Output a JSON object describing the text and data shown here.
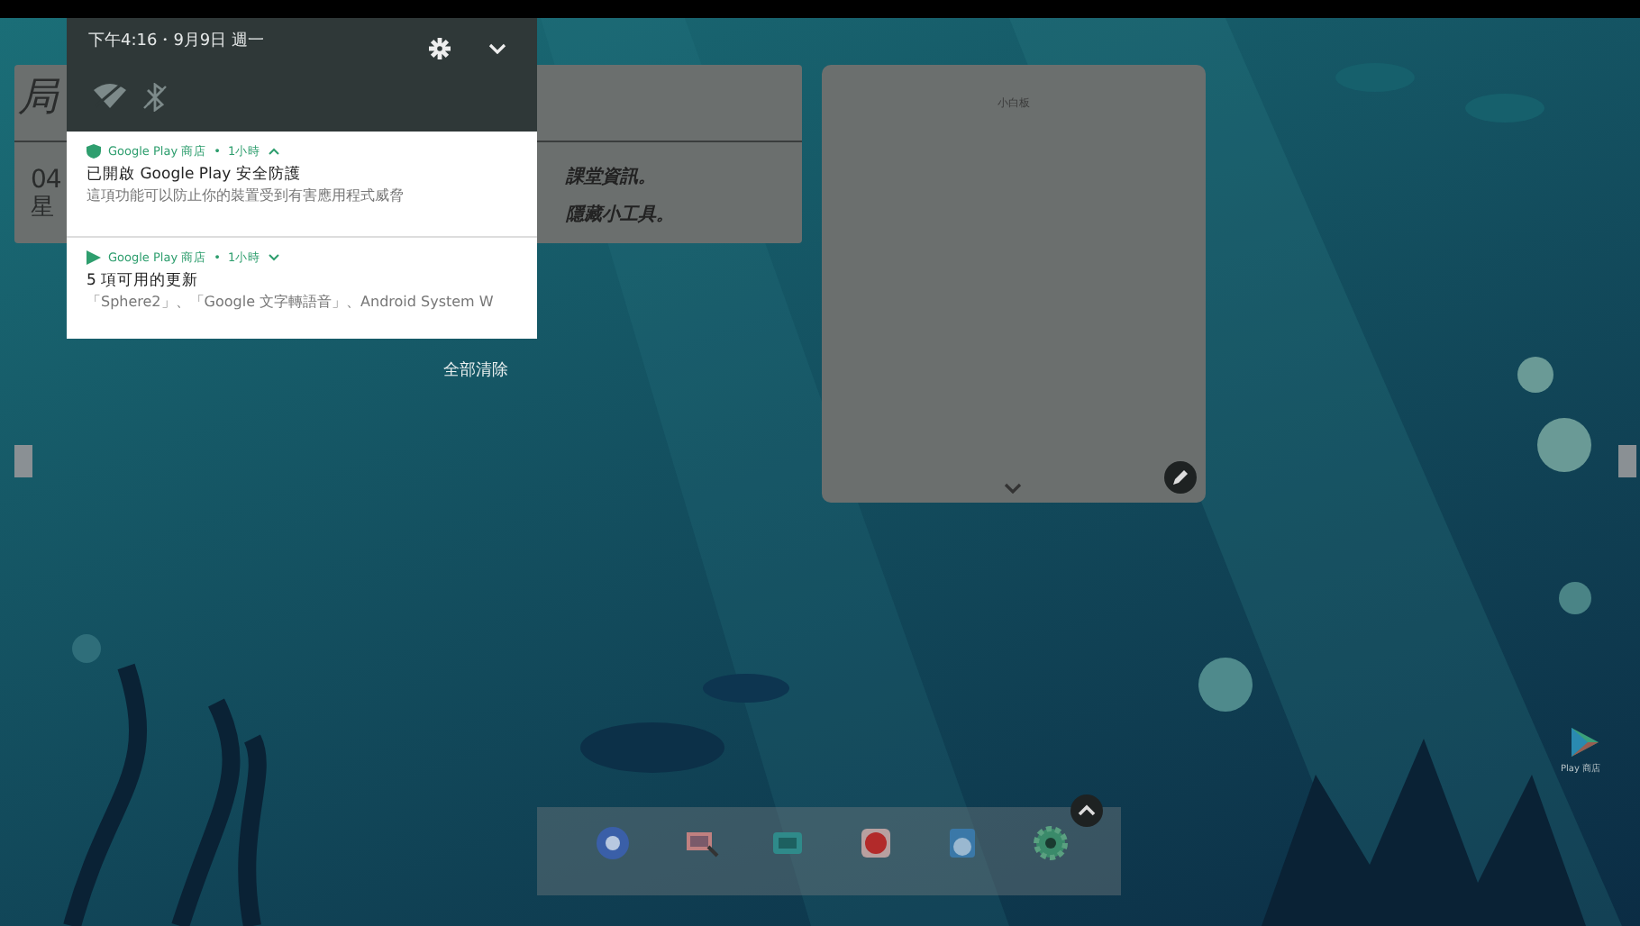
{
  "status_bar": {
    "time_date": "下午4:16・9月9日 週一"
  },
  "quick_toggles": [
    {
      "kind": "wifi",
      "on": false
    },
    {
      "kind": "bluetooth",
      "on": false
    }
  ],
  "notifications": [
    {
      "kind": "shield",
      "app": "Google Play 商店",
      "separator": "•",
      "time": "1小時",
      "expanded": true,
      "title": "已開啟 Google Play 安全防護",
      "text": "這項功能可以防止你的裝置受到有害應用程式威脅"
    },
    {
      "kind": "play",
      "app": "Google Play 商店",
      "separator": "•",
      "time": "1小時",
      "expanded": false,
      "title": "5 項可用的更新",
      "text": "「Sphere2」、「Google 文字轉語音」、Android System W"
    }
  ],
  "clear_all": "全部清除",
  "widget": {
    "heading": "局",
    "date": "04",
    "weekday": "星",
    "lines": [
      "課堂資訊。",
      "隱藏小工具。"
    ]
  },
  "note": {
    "title": "小白板"
  },
  "dock": [
    {
      "kind": "chromium"
    },
    {
      "kind": "whiteboard"
    },
    {
      "kind": "screen"
    },
    {
      "kind": "red-app"
    },
    {
      "kind": "speed"
    },
    {
      "kind": "settings"
    }
  ],
  "shortcut": {
    "label": "Play 商店"
  }
}
